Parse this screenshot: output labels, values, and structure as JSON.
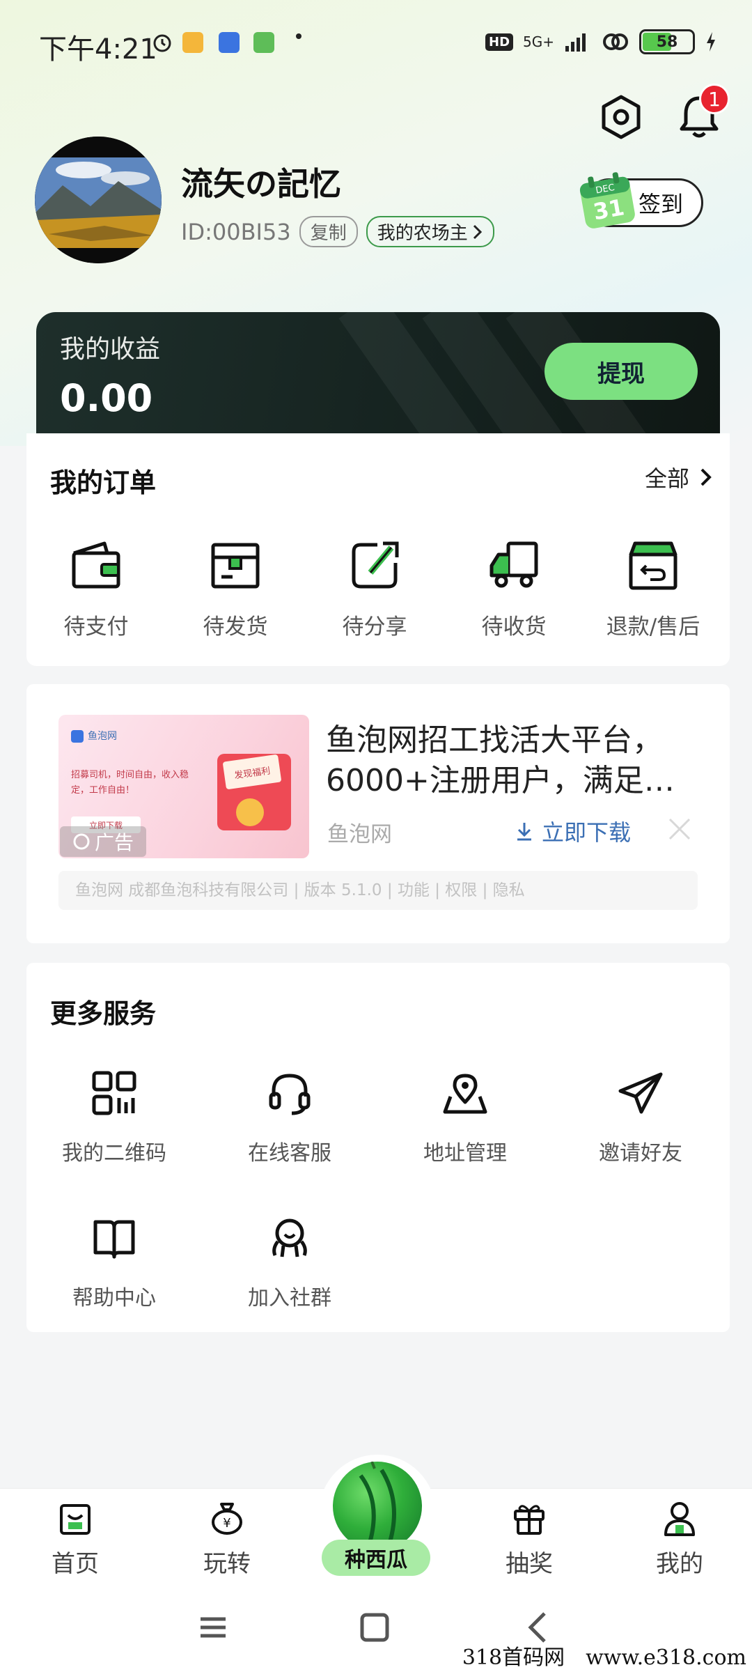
{
  "status_bar": {
    "time": "下午4:21",
    "hd": "HD",
    "network": "5G+",
    "battery": "58"
  },
  "header": {
    "settings_icon": "settings-hexagon-icon",
    "bell_icon": "bell-icon",
    "notification_count": "1"
  },
  "profile": {
    "nickname": "流矢の記忆",
    "id_text": "ID:00BI53",
    "copy_label": "复制",
    "farm_owner_label": "我的农场主",
    "signin_label": "签到",
    "calendar_month": "DEC",
    "calendar_day": "31"
  },
  "earnings": {
    "label": "我的收益",
    "amount": "0.00",
    "withdraw_label": "提现"
  },
  "orders": {
    "title": "我的订单",
    "see_all": "全部",
    "items": [
      {
        "label": "待支付",
        "icon": "wallet-icon"
      },
      {
        "label": "待发货",
        "icon": "box-icon"
      },
      {
        "label": "待分享",
        "icon": "share-edit-icon"
      },
      {
        "label": "待收货",
        "icon": "truck-icon"
      },
      {
        "label": "退款/售后",
        "icon": "return-box-icon"
      }
    ]
  },
  "ad": {
    "title": "鱼泡网招工找活大平台，6000+注册用户，满足…",
    "source": "鱼泡网",
    "download_label": "立即下载",
    "ad_badge": "广告",
    "image_brand": "鱼泡网",
    "image_text": "招募司机，时间自由，收入稳定，工作自由！",
    "image_button": "立即下载",
    "image_envelope": "发现福利",
    "footer": "鱼泡网 成都鱼泡科技有限公司 | 版本 5.1.0 | 功能 | 权限 | 隐私"
  },
  "services": {
    "title": "更多服务",
    "items": [
      {
        "label": "我的二维码",
        "icon": "qrcode-icon"
      },
      {
        "label": "在线客服",
        "icon": "headset-icon"
      },
      {
        "label": "地址管理",
        "icon": "location-icon"
      },
      {
        "label": "邀请好友",
        "icon": "paper-plane-icon"
      },
      {
        "label": "帮助中心",
        "icon": "book-icon"
      },
      {
        "label": "加入社群",
        "icon": "community-icon"
      }
    ]
  },
  "tabbar": {
    "items": [
      {
        "label": "首页",
        "icon": "home-bag-icon"
      },
      {
        "label": "玩转",
        "icon": "money-bag-icon"
      },
      {
        "label": "种西瓜",
        "icon": "watermelon-icon"
      },
      {
        "label": "抽奖",
        "icon": "gift-icon"
      },
      {
        "label": "我的",
        "icon": "user-icon"
      }
    ]
  },
  "watermark": "318首码网　www.e318.com",
  "colors": {
    "accent_green": "#7ce081",
    "dark_card": "#15221f",
    "badge_red": "#e8232f",
    "link_blue": "#3b6fb4"
  }
}
